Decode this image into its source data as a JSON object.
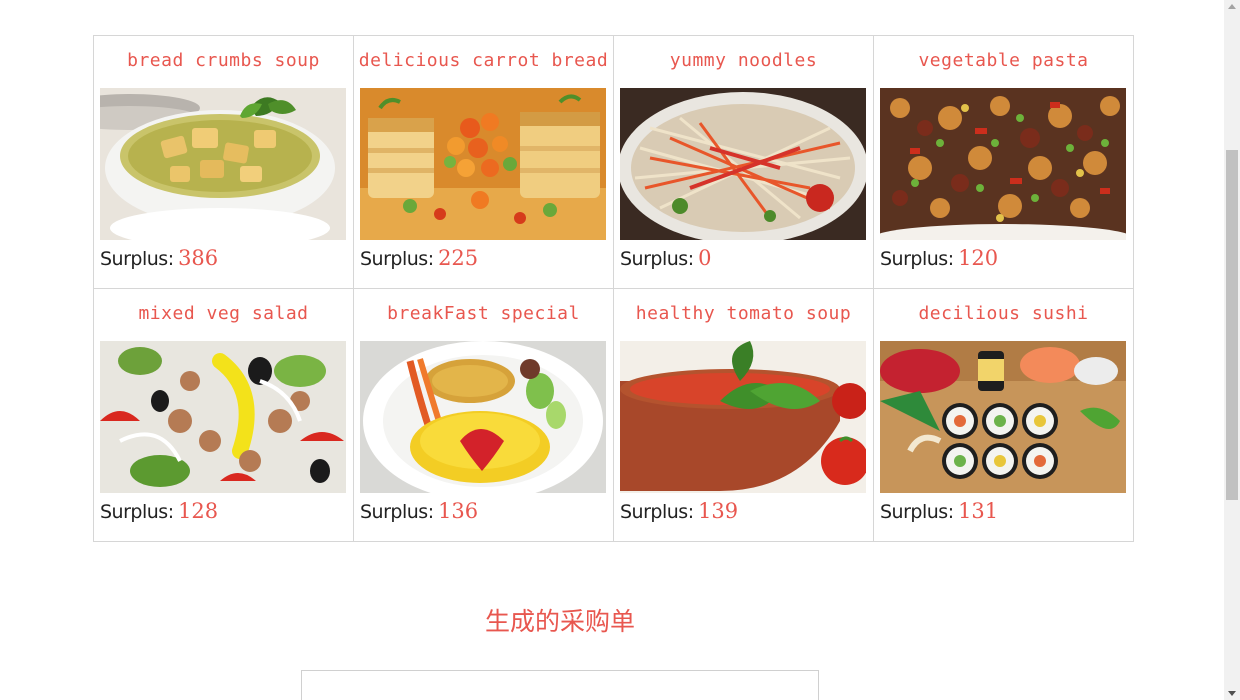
{
  "foods": [
    {
      "title": "bread crumbs soup",
      "surplus_label": "Surplus:",
      "surplus": "386",
      "image": "bread-crumbs-soup-photo"
    },
    {
      "title": "delicious carrot bread",
      "surplus_label": "Surplus:",
      "surplus": "225",
      "image": "carrot-bread-photo"
    },
    {
      "title": "yummy noodles",
      "surplus_label": "Surplus:",
      "surplus": "0",
      "image": "noodles-photo"
    },
    {
      "title": "vegetable pasta",
      "surplus_label": "Surplus:",
      "surplus": "120",
      "image": "vegetable-pasta-photo"
    },
    {
      "title": "mixed veg salad",
      "surplus_label": "Surplus:",
      "surplus": "128",
      "image": "veg-salad-photo"
    },
    {
      "title": "breakFast special",
      "surplus_label": "Surplus:",
      "surplus": "136",
      "image": "breakfast-omelette-photo"
    },
    {
      "title": "healthy tomato soup",
      "surplus_label": "Surplus:",
      "surplus": "139",
      "image": "tomato-soup-photo"
    },
    {
      "title": "decilious sushi",
      "surplus_label": "Surplus:",
      "surplus": "131",
      "image": "sushi-photo"
    }
  ],
  "order": {
    "heading": "生成的采购单"
  },
  "colors": {
    "accent": "#e8574f",
    "border": "#d6d6d6",
    "text": "#222222"
  }
}
